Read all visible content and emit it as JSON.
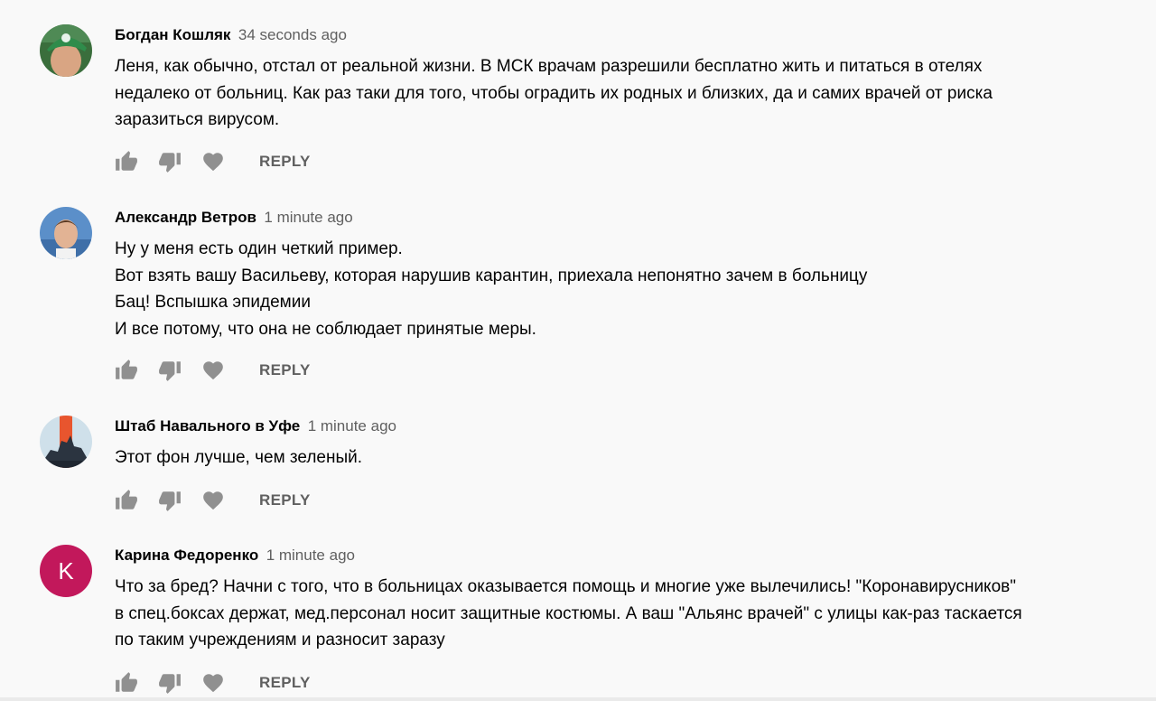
{
  "comments": [
    {
      "author": "Богдан Кошляк",
      "time": "34 seconds ago",
      "lines": [
        "Леня, как обычно, отстал от реальной жизни. В МСК врачам разрешили бесплатно жить и питаться в отелях",
        "недалеко от больниц. Как раз таки для того, чтобы оградить их родных и близких, да и самих врачей от риска",
        "заразиться вирусом."
      ],
      "reply_label": "REPLY"
    },
    {
      "author": "Александр Ветров",
      "time": "1 minute ago",
      "lines": [
        "Ну у меня есть один четкий пример.",
        "Вот взять вашу Васильеву, которая нарушив карантин, приехала непонятно зачем в больницу",
        "Бац! Вспышка эпидемии",
        "И все потому, что она не соблюдает принятые меры."
      ],
      "reply_label": "REPLY"
    },
    {
      "author": "Штаб Навального в Уфе",
      "time": "1 minute ago",
      "lines": [
        "Этот фон лучше, чем зеленый."
      ],
      "reply_label": "REPLY"
    },
    {
      "author": "Карина Федоренко",
      "time": "1 minute ago",
      "avatar_letter": "K",
      "lines": [
        "Что за бред? Начни с того, что в больницах оказывается помощь и многие уже вылечились! \"Коронавирусников\"",
        "в спец.боксах держат, мед.персонал носит защитные костюмы. А ваш \"Альянс врачей\" с улицы как-раз таскается",
        "по таким учреждениям и разносит заразу"
      ],
      "reply_label": "REPLY"
    }
  ],
  "icons": {
    "like": "thumb-up-icon",
    "dislike": "thumb-down-icon",
    "heart": "heart-icon"
  },
  "colors": {
    "background": "#f9f9f9",
    "secondary_text": "#606060",
    "icon": "#909090",
    "letter_avatar": "#c2185b"
  }
}
